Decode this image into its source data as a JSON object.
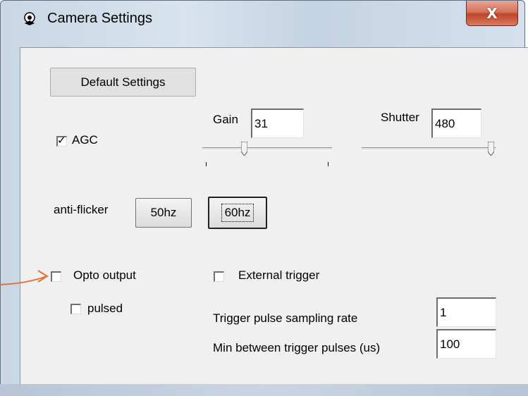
{
  "window": {
    "title": "Camera Settings",
    "close_label": "X",
    "icon": "camera-app-icon"
  },
  "buttons": {
    "default_settings": "Default Settings",
    "hz50": "50hz",
    "hz60": "60hz"
  },
  "agc": {
    "label": "AGC",
    "checked": true
  },
  "gain": {
    "label": "Gain",
    "value": "31",
    "slider_fraction": 0.32
  },
  "shutter": {
    "label": "Shutter",
    "value": "480",
    "slider_fraction": 1.0
  },
  "anti_flicker": {
    "label": "anti-flicker"
  },
  "opto_output": {
    "label": "Opto output",
    "checked": false
  },
  "pulsed": {
    "label": "pulsed",
    "checked": false
  },
  "external_trigger": {
    "label": "External trigger",
    "checked": false
  },
  "trigger_rate": {
    "label": "Trigger pulse sampling rate",
    "value": "1"
  },
  "min_between": {
    "label": "Min between trigger pulses (us)",
    "value": "100"
  },
  "colors": {
    "arrow": "#e0733a",
    "close": "#c7492e"
  }
}
